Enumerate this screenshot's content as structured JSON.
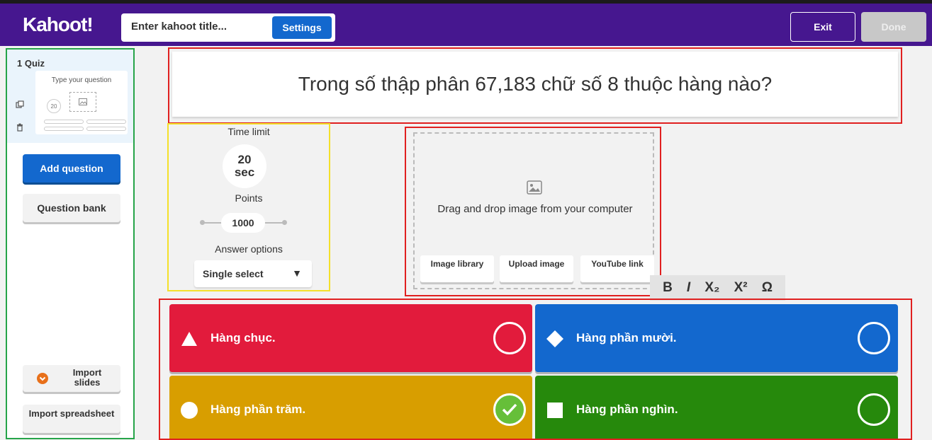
{
  "header": {
    "logo": "Kahoot!",
    "title_placeholder": "Enter kahoot title...",
    "settings_label": "Settings",
    "exit_label": "Exit",
    "done_label": "Done",
    "brand_color": "#46178f"
  },
  "sidebar": {
    "slide_label": "1  Quiz",
    "thumb_question": "Type your question",
    "thumb_time": "20",
    "add_question": "Add question",
    "question_bank": "Question bank",
    "import_slides": "Import slides",
    "import_spreadsheet": "Import spreadsheet",
    "icons": [
      "duplicate-icon",
      "trash-icon"
    ]
  },
  "question": {
    "text": "Trong số thập phân 67,183 chữ số 8 thuộc hàng nào?"
  },
  "settings": {
    "time_label": "Time limit",
    "time_value": "20",
    "time_unit": "sec",
    "points_label": "Points",
    "points_value": "1000",
    "answer_options_label": "Answer options",
    "answer_option_selected": "Single select"
  },
  "media": {
    "drop_text": "Drag and drop image from your computer",
    "buttons": [
      "Image library",
      "Upload image",
      "YouTube link"
    ]
  },
  "format_toolbar": {
    "bold": "B",
    "italic": "I",
    "subscript": "X₂",
    "superscript": "X²",
    "special_char": "Ω"
  },
  "answers": [
    {
      "text": "Hàng chục.",
      "shape": "triangle-icon",
      "color": "#e21b3c",
      "correct": false
    },
    {
      "text": "Hàng phần mười.",
      "shape": "diamond-icon",
      "color": "#1368ce",
      "correct": false
    },
    {
      "text": "Hàng phần trăm.",
      "shape": "circle-icon",
      "color": "#d89e00",
      "correct": true
    },
    {
      "text": "Hàng phần nghìn.",
      "shape": "square-icon",
      "color": "#26890c",
      "correct": false
    }
  ]
}
